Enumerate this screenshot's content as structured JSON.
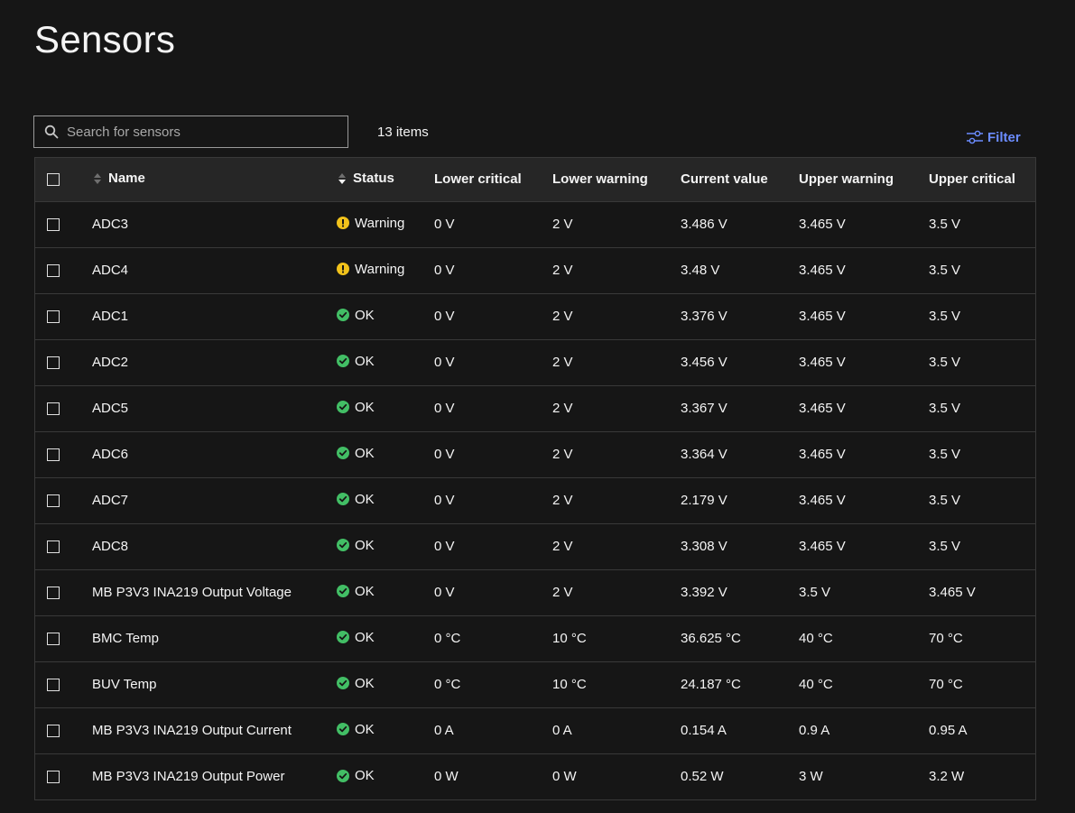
{
  "page": {
    "title": "Sensors"
  },
  "toolbar": {
    "search_placeholder": "Search for sensors",
    "items_count": "13 items",
    "filter_label": "Filter"
  },
  "colors": {
    "background": "#161616",
    "header_bg": "#262626",
    "warning": "#f1c21b",
    "ok": "#42be65",
    "link": "#6b8cff"
  },
  "table": {
    "columns": [
      "Name",
      "Status",
      "Lower critical",
      "Lower warning",
      "Current value",
      "Upper warning",
      "Upper critical"
    ],
    "rows": [
      {
        "name": "ADC3",
        "status": "Warning",
        "status_type": "warning",
        "lower_critical": "0 V",
        "lower_warning": "2 V",
        "current_value": "3.486 V",
        "upper_warning": "3.465 V",
        "upper_critical": "3.5 V"
      },
      {
        "name": "ADC4",
        "status": "Warning",
        "status_type": "warning",
        "lower_critical": "0 V",
        "lower_warning": "2 V",
        "current_value": "3.48 V",
        "upper_warning": "3.465 V",
        "upper_critical": "3.5 V"
      },
      {
        "name": "ADC1",
        "status": "OK",
        "status_type": "ok",
        "lower_critical": "0 V",
        "lower_warning": "2 V",
        "current_value": "3.376 V",
        "upper_warning": "3.465 V",
        "upper_critical": "3.5 V"
      },
      {
        "name": "ADC2",
        "status": "OK",
        "status_type": "ok",
        "lower_critical": "0 V",
        "lower_warning": "2 V",
        "current_value": "3.456 V",
        "upper_warning": "3.465 V",
        "upper_critical": "3.5 V"
      },
      {
        "name": "ADC5",
        "status": "OK",
        "status_type": "ok",
        "lower_critical": "0 V",
        "lower_warning": "2 V",
        "current_value": "3.367 V",
        "upper_warning": "3.465 V",
        "upper_critical": "3.5 V"
      },
      {
        "name": "ADC6",
        "status": "OK",
        "status_type": "ok",
        "lower_critical": "0 V",
        "lower_warning": "2 V",
        "current_value": "3.364 V",
        "upper_warning": "3.465 V",
        "upper_critical": "3.5 V"
      },
      {
        "name": "ADC7",
        "status": "OK",
        "status_type": "ok",
        "lower_critical": "0 V",
        "lower_warning": "2 V",
        "current_value": "2.179 V",
        "upper_warning": "3.465 V",
        "upper_critical": "3.5 V"
      },
      {
        "name": "ADC8",
        "status": "OK",
        "status_type": "ok",
        "lower_critical": "0 V",
        "lower_warning": "2 V",
        "current_value": "3.308 V",
        "upper_warning": "3.465 V",
        "upper_critical": "3.5 V"
      },
      {
        "name": "MB P3V3 INA219 Output Voltage",
        "status": "OK",
        "status_type": "ok",
        "lower_critical": "0 V",
        "lower_warning": "2 V",
        "current_value": "3.392 V",
        "upper_warning": "3.5 V",
        "upper_critical": "3.465 V"
      },
      {
        "name": "BMC Temp",
        "status": "OK",
        "status_type": "ok",
        "lower_critical": "0 °C",
        "lower_warning": "10 °C",
        "current_value": "36.625 °C",
        "upper_warning": "40 °C",
        "upper_critical": "70 °C"
      },
      {
        "name": "BUV Temp",
        "status": "OK",
        "status_type": "ok",
        "lower_critical": "0 °C",
        "lower_warning": "10 °C",
        "current_value": "24.187 °C",
        "upper_warning": "40 °C",
        "upper_critical": "70 °C"
      },
      {
        "name": "MB P3V3 INA219 Output Current",
        "status": "OK",
        "status_type": "ok",
        "lower_critical": "0 A",
        "lower_warning": "0 A",
        "current_value": "0.154 A",
        "upper_warning": "0.9 A",
        "upper_critical": "0.95 A"
      },
      {
        "name": "MB P3V3 INA219 Output Power",
        "status": "OK",
        "status_type": "ok",
        "lower_critical": "0 W",
        "lower_warning": "0 W",
        "current_value": "0.52 W",
        "upper_warning": "3 W",
        "upper_critical": "3.2 W"
      }
    ]
  }
}
